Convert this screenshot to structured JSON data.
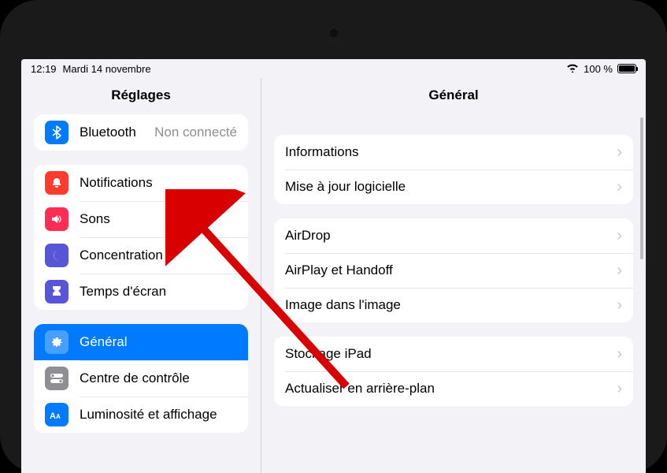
{
  "status": {
    "time": "12:19",
    "date": "Mardi 14 novembre",
    "battery_pct": "100 %"
  },
  "sidebar": {
    "title": "Réglages",
    "group0": {
      "bluetooth": {
        "label": "Bluetooth",
        "status": "Non connecté"
      }
    },
    "group1": {
      "notifications": {
        "label": "Notifications"
      },
      "sounds": {
        "label": "Sons"
      },
      "focus": {
        "label": "Concentration"
      },
      "screentime": {
        "label": "Temps d'écran"
      }
    },
    "group2": {
      "general": {
        "label": "Général"
      },
      "controlcenter": {
        "label": "Centre de contrôle"
      },
      "display": {
        "label": "Luminosité et affichage"
      }
    }
  },
  "detail": {
    "title": "Général",
    "g1": {
      "info": {
        "label": "Informations"
      },
      "update": {
        "label": "Mise à jour logicielle"
      }
    },
    "g2": {
      "airdrop": {
        "label": "AirDrop"
      },
      "airplay": {
        "label": "AirPlay et Handoff"
      },
      "pip": {
        "label": "Image dans l'image"
      }
    },
    "g3": {
      "storage": {
        "label": "Stockage iPad"
      },
      "background": {
        "label": "Actualiser en arrière-plan"
      }
    }
  },
  "colors": {
    "blue": "#007aff",
    "red": "#ff3b30",
    "pink": "#ff2d55",
    "indigo": "#5856d6",
    "gray": "#8e8e93"
  }
}
